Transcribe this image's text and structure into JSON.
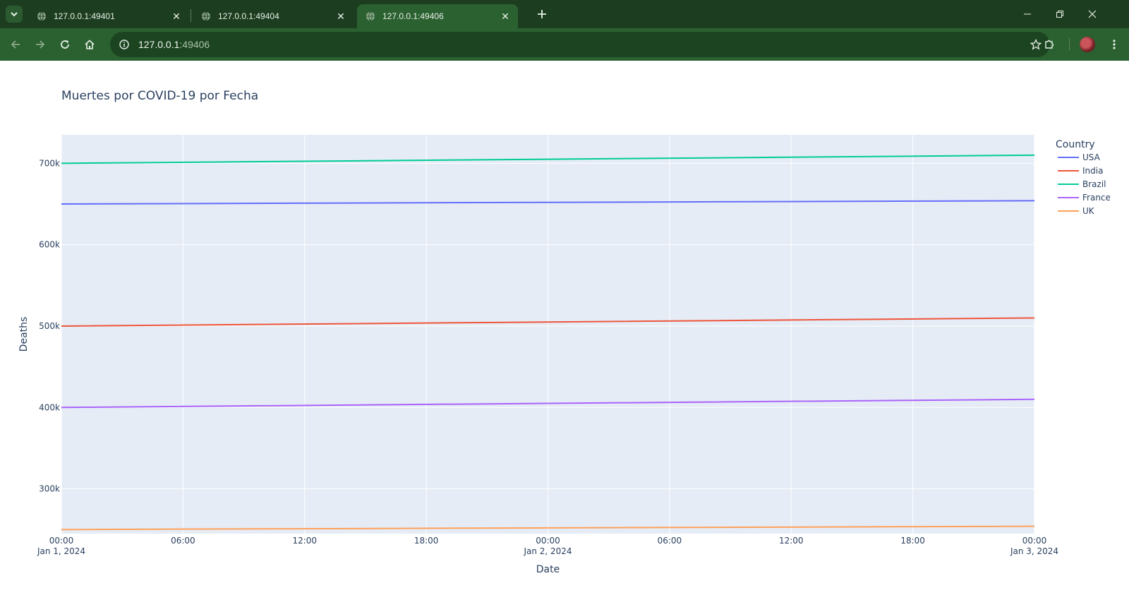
{
  "browser": {
    "tabs": [
      {
        "title": "127.0.0.1:49401",
        "active": false
      },
      {
        "title": "127.0.0.1:49404",
        "active": false
      },
      {
        "title": "127.0.0.1:49406",
        "active": true
      }
    ],
    "address": {
      "host": "127.0.0.1",
      "port": ":49406"
    }
  },
  "chart_data": {
    "type": "line",
    "title": "Muertes por COVID-19 por Fecha",
    "xlabel": "Date",
    "ylabel": "Deaths",
    "legend_title": "Country",
    "legend_placement": "top-right",
    "grid": true,
    "x": [
      "2024-01-01",
      "2024-01-02",
      "2024-01-03"
    ],
    "xlim": [
      "2024-01-01 00:00",
      "2024-01-03 00:00"
    ],
    "ylim": [
      245000,
      735000
    ],
    "x_ticks": [
      {
        "t": "2024-01-01 00:00",
        "label": "00:00",
        "sub": "Jan 1, 2024"
      },
      {
        "t": "2024-01-01 06:00",
        "label": "06:00",
        "sub": ""
      },
      {
        "t": "2024-01-01 12:00",
        "label": "12:00",
        "sub": ""
      },
      {
        "t": "2024-01-01 18:00",
        "label": "18:00",
        "sub": ""
      },
      {
        "t": "2024-01-02 00:00",
        "label": "00:00",
        "sub": "Jan 2, 2024"
      },
      {
        "t": "2024-01-02 06:00",
        "label": "06:00",
        "sub": ""
      },
      {
        "t": "2024-01-02 12:00",
        "label": "12:00",
        "sub": ""
      },
      {
        "t": "2024-01-02 18:00",
        "label": "18:00",
        "sub": ""
      },
      {
        "t": "2024-01-03 00:00",
        "label": "00:00",
        "sub": "Jan 3, 2024"
      }
    ],
    "y_ticks": [
      {
        "v": 300000,
        "label": "300k"
      },
      {
        "v": 400000,
        "label": "400k"
      },
      {
        "v": 500000,
        "label": "500k"
      },
      {
        "v": 600000,
        "label": "600k"
      },
      {
        "v": 700000,
        "label": "700k"
      }
    ],
    "series": [
      {
        "name": "USA",
        "color": "#636efa",
        "values": [
          650000,
          652000,
          654000
        ]
      },
      {
        "name": "India",
        "color": "#ef553b",
        "values": [
          500000,
          505000,
          510000
        ]
      },
      {
        "name": "Brazil",
        "color": "#00cc96",
        "values": [
          700000,
          705000,
          710000
        ]
      },
      {
        "name": "France",
        "color": "#ab63fa",
        "values": [
          400000,
          405000,
          410000
        ]
      },
      {
        "name": "UK",
        "color": "#ffa15a",
        "values": [
          250000,
          252000,
          254000
        ]
      }
    ]
  }
}
